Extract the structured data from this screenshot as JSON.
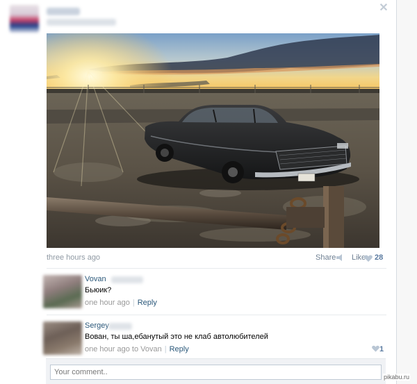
{
  "post": {
    "time": "three hours ago",
    "share_label": "Share",
    "like_label": "Like",
    "like_count": "28",
    "close_icon": "close-icon"
  },
  "comments": [
    {
      "author": "Vovan",
      "text": "Бьюик?",
      "time": "one hour ago",
      "reply_label": "Reply"
    },
    {
      "author": "Sergey",
      "text": "Вован, ты ша,ебанутый это не клаб автолюбителей",
      "time": "one hour ago to Vovan",
      "reply_label": "Reply",
      "like_count": "1"
    }
  ],
  "reply_box": {
    "placeholder": "Your comment.."
  },
  "watermark": "pikabu.ru",
  "colors": {
    "link": "#2b587a",
    "muted": "#909aa4",
    "like_count": "#5a7aa0"
  }
}
